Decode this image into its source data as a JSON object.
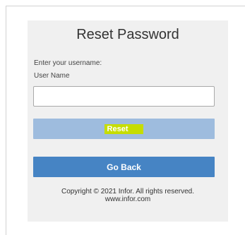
{
  "form": {
    "title": "Reset Password",
    "prompt": "Enter your username:",
    "username_label": "User Name",
    "username_value": "",
    "username_placeholder": ""
  },
  "buttons": {
    "reset_label": "Reset",
    "go_back_label": "Go Back"
  },
  "footer": {
    "copyright": "Copyright © 2021 Infor. All rights reserved.",
    "website": "www.infor.com"
  },
  "colors": {
    "panel_background": "#f0f0f0",
    "reset_button": "#9ebcde",
    "reset_highlight": "#c6dd00",
    "go_back_button": "#4684c4"
  }
}
